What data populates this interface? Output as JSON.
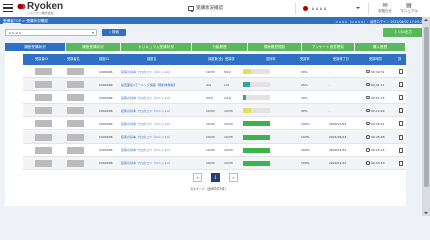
{
  "header": {
    "logo_text": "Ryoken",
    "logo_sub": "リョーケン株式会社",
    "status_button": "受講状況確認",
    "user_name": "ｕｕｕｕ",
    "notice_label": "お知らせ",
    "manual_label": "マニュアル",
    "brand_color": "#a00000"
  },
  "breadcrumb": {
    "top": "受講者TOP",
    "sep": ">",
    "current": "受講状況確認"
  },
  "sysinfo": "ｕｕｕｕ（ｕｕｕｕ）：最終ログイン 2021/06/02 17:03:27",
  "filters": {
    "course_value": "ｕｕｕｕ",
    "search_label": "検索",
    "csv_label": "CSV出力"
  },
  "tabs": [
    {
      "label": "講座受講状況",
      "active": true
    },
    {
      "label": "講座受講状況",
      "active": false
    },
    {
      "label": "カリキュラム受講状況",
      "active": false
    },
    {
      "label": "行動履歴",
      "active": false
    },
    {
      "label": "視聴履歴閲覧",
      "active": false
    },
    {
      "label": "アンケート回答閲覧",
      "active": false
    },
    {
      "label": "購入履歴",
      "active": false
    }
  ],
  "table": {
    "headers": [
      "受講者ID",
      "受講者名",
      "講座ID",
      "講座名",
      "講座数(全)",
      "受講済",
      "進捗率",
      "受講率",
      "受講修了日",
      "受講時間",
      "詳"
    ],
    "rows": [
      {
        "course_id": "C000006",
        "course_name": "接客の基本 プロのコツ（ユニット1）",
        "total": "10/33",
        "done": "5/10",
        "progress": 0.3,
        "bar_color": "#e0e05a",
        "rate": "30%",
        "complete": "-",
        "time": "00:32:31"
      },
      {
        "course_id": "C000009",
        "course_name": "採否面接eラーニング講座【無料体験版】",
        "total": "4/4",
        "done": "1/4",
        "progress": 0.25,
        "bar_color": "#2aa7a4",
        "rate": "25%",
        "complete": "-",
        "time": "00:01:11"
      },
      {
        "course_id": "C000006",
        "course_name": "接客の基本 プロのコツ（ユニット1）",
        "total": "5/10",
        "done": "1/10",
        "progress": 0.1,
        "bar_color": "#2aa7a4",
        "rate": "10%",
        "complete": "-",
        "time": "00:21:15"
      },
      {
        "course_id": "C000006",
        "course_name": "接客の基本 プロのコツ（ユニット1）",
        "total": "10/33",
        "done": "10/33",
        "progress": 0.3,
        "bar_color": "#e0e05a",
        "rate": "30%",
        "complete": "-",
        "time": "00:12:49"
      },
      {
        "course_id": "C000006",
        "course_name": "接客の基本 プロのコツ（ユニット1）",
        "total": "10/33",
        "done": "10/33",
        "progress": 1.0,
        "bar_color": "#3cb44b",
        "rate": "100%",
        "complete": "2020/11/23",
        "time": "00:35:41"
      },
      {
        "course_id": "C000006",
        "course_name": "接客の基本 プロのコツ（ユニット1）",
        "total": "10/33",
        "done": "10/33",
        "progress": 1.0,
        "bar_color": "#3cb44b",
        "rate": "100%",
        "complete": "2021/04/13",
        "time": "00:25:48"
      },
      {
        "course_id": "C000006",
        "course_name": "接客の基本 プロのコツ（ユニット1）",
        "total": "10/33",
        "done": "10/33",
        "progress": 1.0,
        "bar_color": "#3cb44b",
        "rate": "100%",
        "complete": "2020/12/31",
        "time": "00:25:14"
      },
      {
        "course_id": "C000006",
        "course_name": "接客の基本 プロのコツ（ユニット1）",
        "total": "10/33",
        "done": "10/33",
        "progress": 1.0,
        "bar_color": "#3cb44b",
        "rate": "100%",
        "complete": "2020/12/31",
        "time": "00:03:43"
      }
    ]
  },
  "pagination": {
    "prev": "«",
    "current": "1",
    "next": "»",
    "summary": "1/1ページ（全8件中1件）"
  }
}
